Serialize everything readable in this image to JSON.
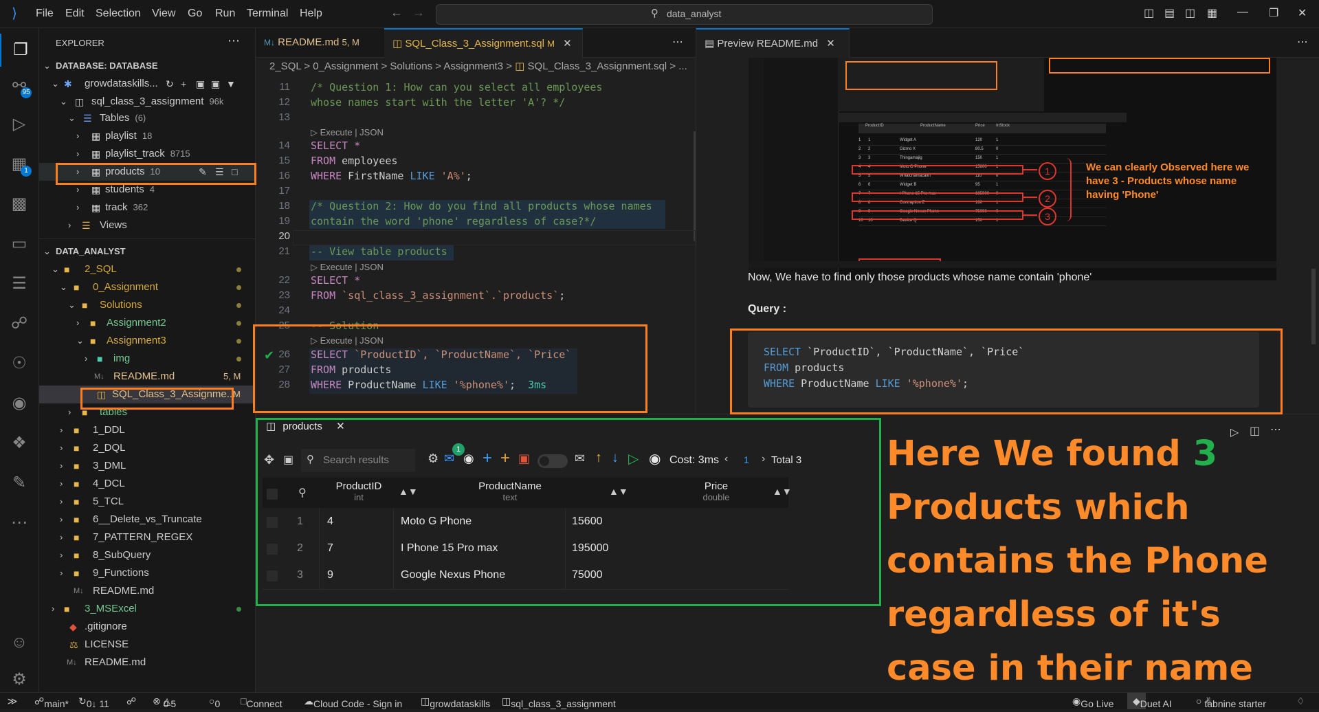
{
  "window": {
    "menu": [
      "File",
      "Edit",
      "Selection",
      "View",
      "Go",
      "Run",
      "Terminal",
      "Help"
    ],
    "search_text": "data_analyst"
  },
  "activity": {
    "source_control_badge": "95",
    "extensions_badge": "1"
  },
  "explorer": {
    "header": "EXPLORER",
    "db_section": "DATABASE: DATABASE",
    "connection": "growdataskills...",
    "schema": "sql_class_3_assignment",
    "schema_size": "96k",
    "tables_label": "Tables",
    "tables_count": "(6)",
    "tables": [
      {
        "name": "playlist",
        "count": "18"
      },
      {
        "name": "playlist_track",
        "count": "8715"
      },
      {
        "name": "products",
        "count": "10"
      },
      {
        "name": "students",
        "count": "4"
      },
      {
        "name": "track",
        "count": "362"
      }
    ],
    "views_label": "Views",
    "workspace_section": "DATA_ANALYST",
    "tree": {
      "sql": "2_SQL",
      "assignment": "0_Assignment",
      "solutions": "Solutions",
      "assignment2": "Assignment2",
      "assignment3": "Assignment3",
      "img": "img",
      "readme_md": "README.md",
      "readme_status": "5, M",
      "sql_file": "SQL_Class_3_Assignme...",
      "sql_file_status": "M",
      "tables": "tables",
      "folders": [
        "1_DDL",
        "2_DQL",
        "3_DML",
        "4_DCL",
        "5_TCL",
        "6__Delete_vs_Truncate",
        "7_PATTERN_REGEX",
        "8_SubQuery",
        "9_Functions"
      ],
      "sql_readme": "README.md",
      "msexcel": "3_MSExcel",
      "gitignore": ".gitignore",
      "license": "LICENSE",
      "root_readme": "README.md"
    }
  },
  "editor": {
    "tab1": "README.md",
    "tab1_status": "5, M",
    "tab2": "SQL_Class_3_Assignment.sql",
    "tab2_status": "M",
    "breadcrumb": "2_SQL > 0_Assignment > Solutions > Assignment3 > ",
    "breadcrumb_file": "SQL_Class_3_Assignment.sql > ...",
    "codelens": "Execute | JSON",
    "lines": {
      "n11": "11",
      "n12": "12",
      "n13": "13",
      "n14": "14",
      "n15": "15",
      "n16": "16",
      "n17": "17",
      "n18": "18",
      "n19": "19",
      "n20": "20",
      "n21": "21",
      "n22": "22",
      "n23": "23",
      "n24": "24",
      "n25": "25",
      "n26": "26",
      "n27": "27",
      "n28": "28"
    },
    "code": {
      "l11": "/* Question 1: How can you select all employees",
      "l12": "whose names start with the letter 'A'? */",
      "l14_kw": "SELECT *",
      "l15_kw": "FROM",
      "l15_id": " employees",
      "l16_kw": "WHERE",
      "l16_id": " FirstName ",
      "l16_kw2": "LIKE",
      "l16_str": " 'A%'",
      "l16_end": ";",
      "l18": "/* Question 2: How do you find all products whose names",
      "l19": "contain the word 'phone' regardless of case?*/",
      "l21": "-- View table products",
      "l22_kw": "SELECT *",
      "l23_kw": "FROM",
      "l23_str": " `sql_class_3_assignment`.`products`",
      "l23_end": ";",
      "l25": "-- Solution",
      "l26_kw": "SELECT",
      "l26_str": " `ProductID`, `ProductName`, `Price`",
      "l27_kw": "FROM",
      "l27_id": " products",
      "l28_kw": "WHERE",
      "l28_id": " ProductName ",
      "l28_kw2": "LIKE",
      "l28_str": " '%phone%'",
      "l28_end": ";",
      "l28_time": "3ms"
    }
  },
  "preview": {
    "tab": "Preview README.md",
    "note_observed": "We can clearly Observed here we have 3 - Products whose name having 'Phone'",
    "para": "Now, We have to find only those products whose name contain 'phone'",
    "query_label": "Query :",
    "q_select": "SELECT",
    "q_cols": " `ProductID`, `ProductName`, `Price`",
    "q_from": "FROM",
    "q_table": " products",
    "q_where": "WHERE",
    "q_col": " ProductName ",
    "q_like": "LIKE",
    "q_pat": " '%phone%'",
    "q_end": ";",
    "thumb_cols": [
      "ProductID",
      "ProductName",
      "Price",
      "InStock"
    ],
    "thumb_rows": [
      [
        "1",
        "1",
        "Widget A",
        "120",
        "1"
      ],
      [
        "2",
        "2",
        "Gizmo X",
        "80.5",
        "0"
      ],
      [
        "3",
        "3",
        "Thingamajig",
        "150",
        "1"
      ],
      [
        "4",
        "4",
        "Moto G Phone",
        "15600",
        "1"
      ],
      [
        "5",
        "5",
        "WhatchamacalliT",
        "110",
        "0"
      ],
      [
        "6",
        "6",
        "Widget B",
        "95",
        "1"
      ],
      [
        "7",
        "7",
        "I Phone 15 Pro max",
        "195000",
        "0"
      ],
      [
        "8",
        "8",
        "Contraption Z",
        "180",
        "1"
      ],
      [
        "9",
        "9",
        "Google Nexus Phone",
        "75000",
        "0"
      ],
      [
        "10",
        "10",
        "Device Q",
        "150",
        "1"
      ]
    ],
    "circle_1": "1",
    "circle_2": "2",
    "circle_3": "3"
  },
  "results": {
    "tab": "products",
    "search_placeholder": "Search results",
    "mail_badge": "1",
    "cost": "Cost: 3ms",
    "page": "1",
    "total": "Total 3",
    "columns": [
      {
        "name": "ProductID",
        "type": "int"
      },
      {
        "name": "ProductName",
        "type": "text"
      },
      {
        "name": "Price",
        "type": "double"
      }
    ],
    "rows": [
      {
        "idx": "1",
        "id": "4",
        "name": "Moto G Phone",
        "price": "15600"
      },
      {
        "idx": "2",
        "id": "7",
        "name": "I Phone 15 Pro max",
        "price": "195000"
      },
      {
        "idx": "3",
        "id": "9",
        "name": "Google Nexus Phone",
        "price": "75000"
      }
    ]
  },
  "annotation": {
    "part1": "Here We found ",
    "number": "3",
    "part2": " Products which contains the Phone regardless of it's case in their name"
  },
  "statusbar": {
    "branch": "main*",
    "sync": "0↓ 11",
    "errors": "0",
    "warnings": "5",
    "ports": "0",
    "connect": "Connect",
    "cloud": "Cloud Code - Sign in",
    "db": "growdataskills",
    "schema": "sql_class_3_assignment",
    "golive": "Go Live",
    "duet": "Duet AI",
    "tabnine": "tabnine starter"
  },
  "colors": {
    "accent": "#0078d4",
    "annotation_orange": "#ff7f1e",
    "annotation_green": "#22b04c"
  }
}
